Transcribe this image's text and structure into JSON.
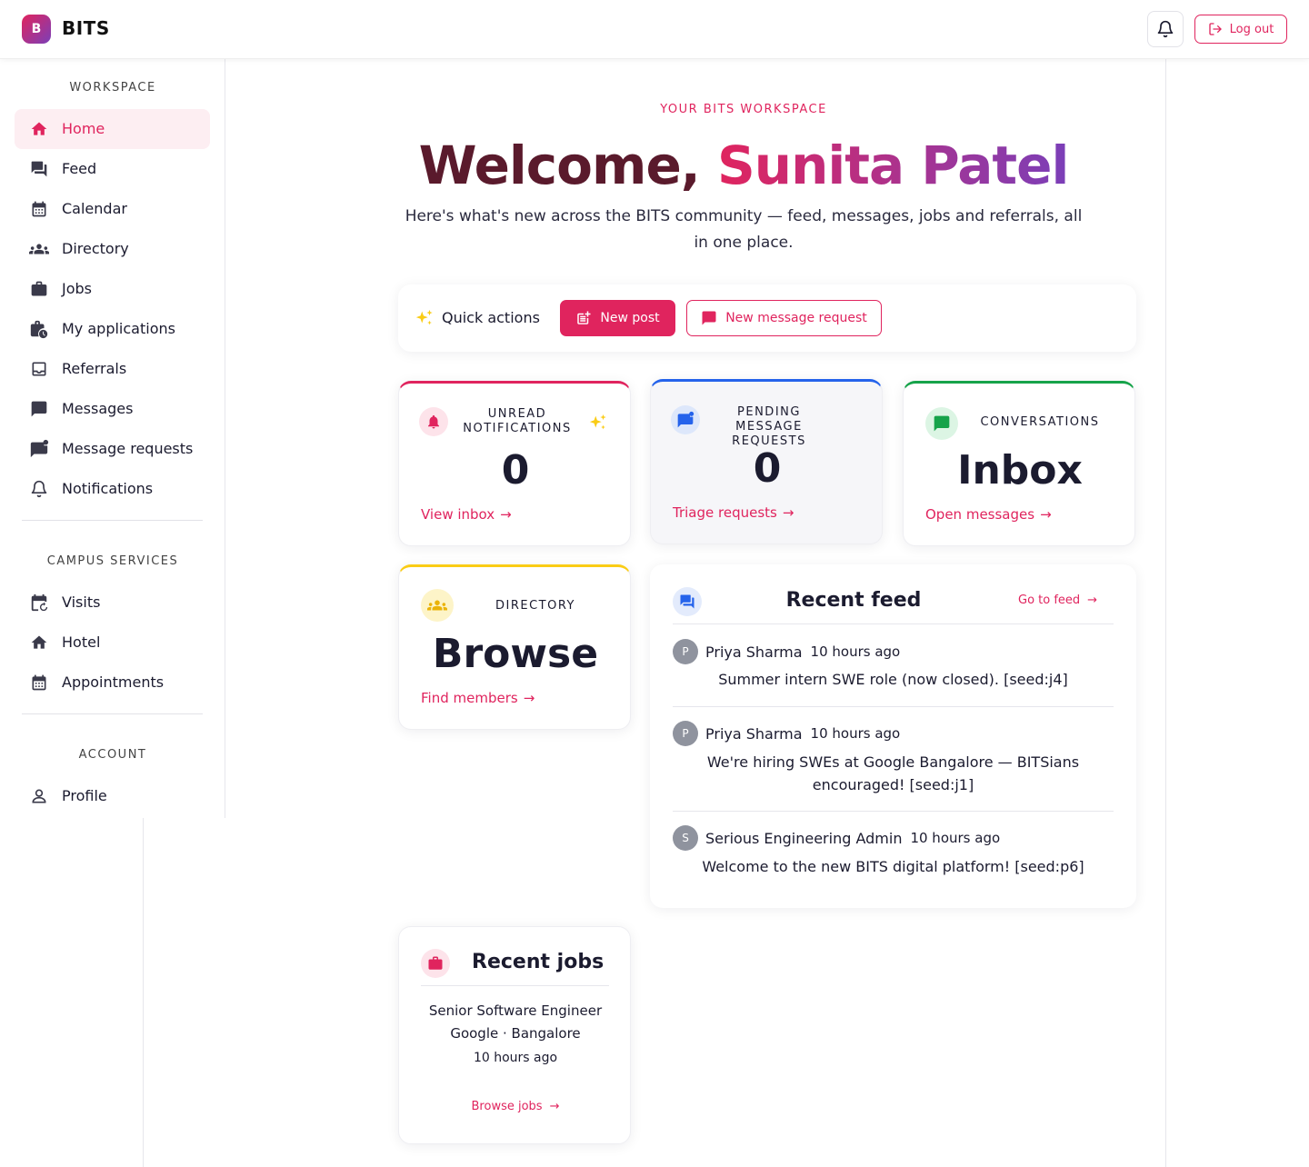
{
  "app": {
    "brand": "BITS",
    "logo_letter": "B"
  },
  "header": {
    "logout_label": "Log out"
  },
  "sidebar": {
    "workspace_label": "WORKSPACE",
    "workspace_items": [
      {
        "label": "Home",
        "icon": "home-icon"
      },
      {
        "label": "Feed",
        "icon": "forum-icon"
      },
      {
        "label": "Calendar",
        "icon": "calendar-icon"
      },
      {
        "label": "Directory",
        "icon": "people-icon"
      },
      {
        "label": "Jobs",
        "icon": "briefcase-icon"
      },
      {
        "label": "My applications",
        "icon": "briefcase-clock-icon"
      },
      {
        "label": "Referrals",
        "icon": "inbox-icon"
      },
      {
        "label": "Messages",
        "icon": "chat-icon"
      },
      {
        "label": "Message requests",
        "icon": "chat-badge-icon"
      },
      {
        "label": "Notifications",
        "icon": "bell-icon"
      }
    ],
    "campus_label": "CAMPUS SERVICES",
    "campus_items": [
      {
        "label": "Visits",
        "icon": "calendar-return-icon"
      },
      {
        "label": "Hotel",
        "icon": "home-icon"
      },
      {
        "label": "Appointments",
        "icon": "calendar-icon"
      }
    ],
    "account_label": "ACCOUNT",
    "account_items": [
      {
        "label": "Profile",
        "icon": "person-icon"
      }
    ]
  },
  "hero": {
    "eyebrow": "YOUR BITS WORKSPACE",
    "welcome": "Welcome, ",
    "name": "Sunita Patel",
    "lede": "Here's what's new across the BITS community — feed, messages, jobs and referrals, all in one place."
  },
  "quick_actions": {
    "title": "Quick actions",
    "new_post": "New post",
    "new_message_request": "New message request"
  },
  "stats": {
    "notifications": {
      "label": "UNREAD NOTIFICATIONS",
      "value": "0",
      "link": "View inbox"
    },
    "requests": {
      "label": "PENDING MESSAGE REQUESTS",
      "value": "0",
      "link": "Triage requests"
    },
    "conversations": {
      "label": "CONVERSATIONS",
      "value": "Inbox",
      "link": "Open messages"
    },
    "directory": {
      "label": "DIRECTORY",
      "value": "Browse",
      "link": "Find members"
    }
  },
  "feed": {
    "title": "Recent feed",
    "link": "Go to feed",
    "posts": [
      {
        "initial": "P",
        "author": "Priya Sharma",
        "time": "10 hours ago",
        "body": "Summer intern SWE role (now closed). [seed:j4]"
      },
      {
        "initial": "P",
        "author": "Priya Sharma",
        "time": "10 hours ago",
        "body": "We're hiring SWEs at Google Bangalore — BITSians encouraged! [seed:j1]"
      },
      {
        "initial": "S",
        "author": "Serious Engineering Admin",
        "time": "10 hours ago",
        "body": "Welcome to the new BITS digital platform! [seed:p6]"
      }
    ]
  },
  "jobs": {
    "title": "Recent jobs",
    "job_title": "Senior Software Engineer",
    "job_meta": "Google · Bangalore",
    "job_time": "10 hours ago",
    "link": "Browse jobs"
  },
  "colors": {
    "accent": "#e0245e",
    "blue": "#2563eb",
    "green": "#16a34a",
    "yellow": "#facc15"
  }
}
